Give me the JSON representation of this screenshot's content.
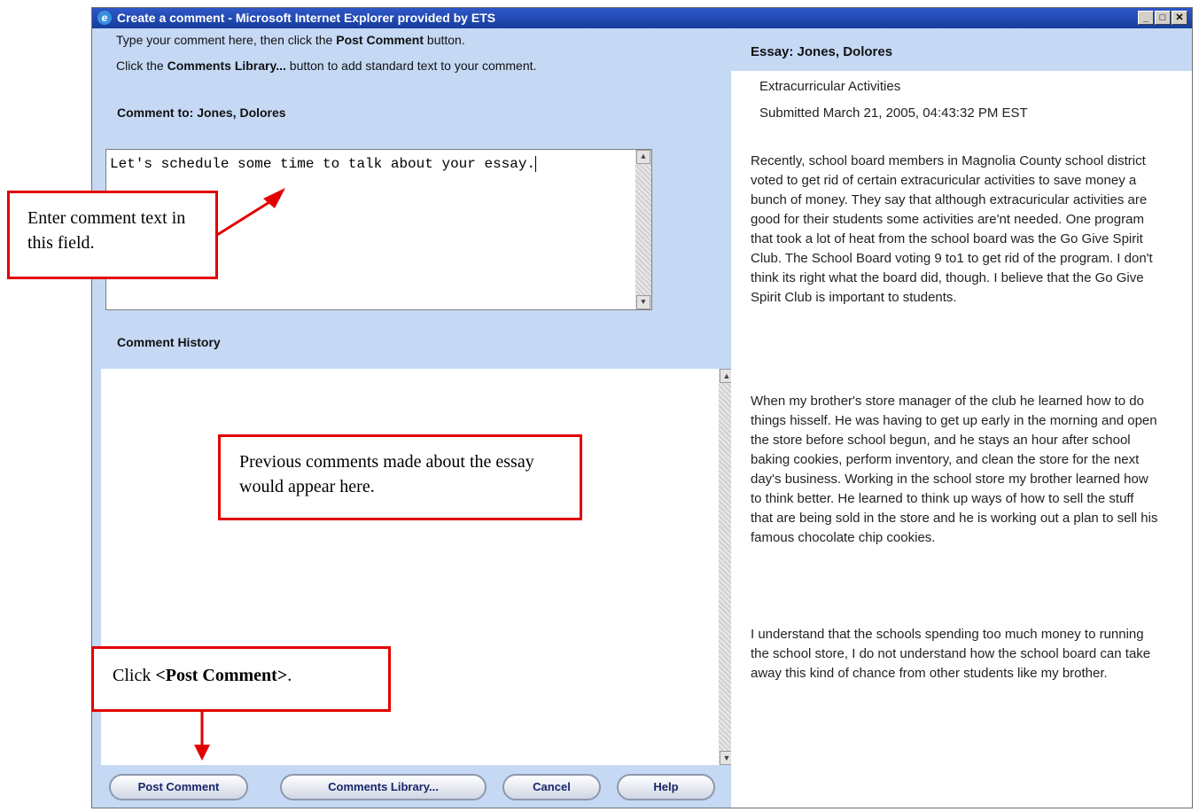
{
  "window": {
    "title": "Create a comment - Microsoft Internet Explorer provided by ETS"
  },
  "instructions": {
    "line1_pre": "Type your comment here, then click the ",
    "line1_bold": "Post Comment",
    "line1_post": " button.",
    "line2_pre": "Click the ",
    "line2_bold": "Comments Library...",
    "line2_post": " button to add standard text to your comment."
  },
  "comment_to_label": "Comment to: Jones, Dolores",
  "comment_text": "Let's schedule some time to talk about your essay.",
  "history_label": "Comment History",
  "buttons": {
    "post": "Post Comment",
    "library": "Comments Library...",
    "cancel": "Cancel",
    "help": "Help"
  },
  "essay": {
    "header": "Essay: Jones, Dolores",
    "topic": "Extracurricular Activities",
    "submitted": "Submitted March 21, 2005, 04:43:32 PM EST",
    "paragraphs": [
      "Recently, school board members in Magnolia County school district voted to get rid of certain extracuricular activities to save money a bunch of money. They say that although extracuricular activities are good for their students some activities are'nt needed. One program that took a lot of heat from the school board was the Go Give Spirit Club. The School Board voting 9 to1 to get rid of the program. I don't think its right what the board did, though. I believe that the Go Give Spirit Club is important to students.",
      "When my brother's store manager of the club he learned how to do things hisself. He was having to get up early in the morning and open the store before school begun, and he stays an hour after school baking cookies, perform inventory, and clean the store for the next day's business. Working in the school store my brother learned how to think better. He learned to think up ways of how to sell the stuff that are being sold in the store and he is working out a plan to sell his famous chocolate chip cookies.",
      "I understand that the schools spending too much money to running the school store, I do not understand how the school board can take away this kind of chance from other students like my brother."
    ]
  },
  "callouts": {
    "enter_text": "Enter comment text in this field.",
    "previous": "Previous comments made about the essay would appear here.",
    "click_pre": "Click ",
    "click_bold": "<Post Comment>",
    "click_post": "."
  },
  "colors": {
    "panel_bg": "#c5d9f5",
    "titlebar": "#2350b8",
    "callout_border": "#e30000",
    "button_text": "#18266b"
  }
}
